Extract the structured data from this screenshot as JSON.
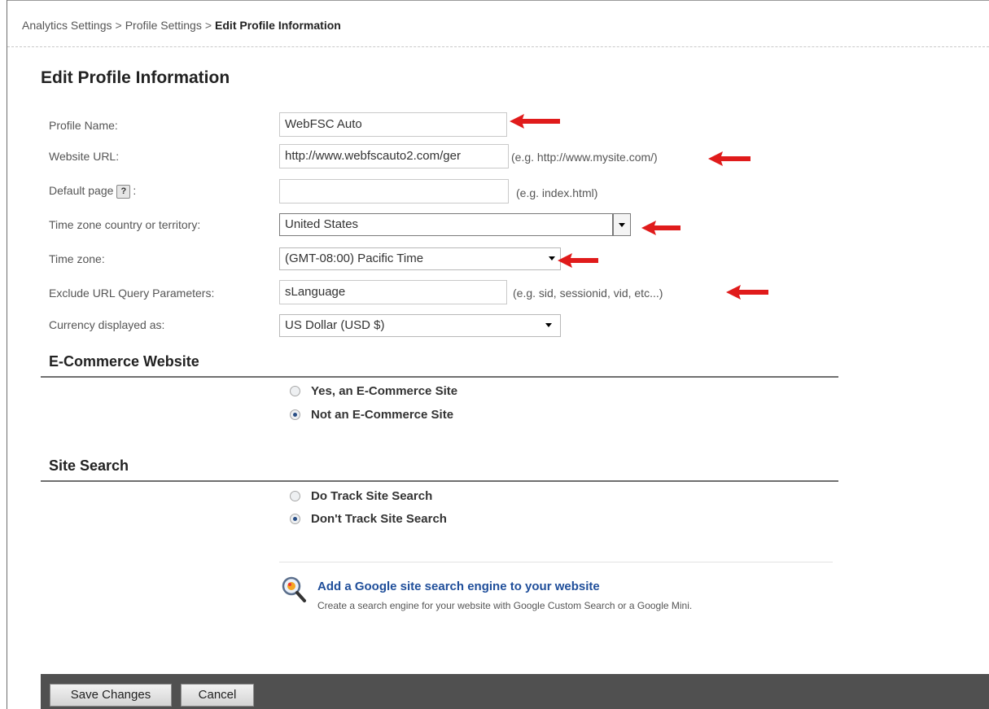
{
  "breadcrumb": {
    "items": [
      "Analytics Settings",
      "Profile Settings"
    ],
    "separator": ">",
    "current": "Edit Profile Information"
  },
  "page_title": "Edit Profile Information",
  "form": {
    "profile_name": {
      "label": "Profile Name:",
      "value": "WebFSC Auto"
    },
    "website_url": {
      "label": "Website URL:",
      "value": "http://www.webfscauto2.com/ger",
      "hint": "(e.g. http://www.mysite.com/)"
    },
    "default_page": {
      "label": "Default page",
      "label_suffix": ":",
      "help_glyph": "?",
      "value": "",
      "hint": "(e.g. index.html)"
    },
    "time_zone_country": {
      "label": "Time zone country or territory:",
      "value": "United States"
    },
    "time_zone": {
      "label": "Time zone:",
      "value": "(GMT-08:00) Pacific Time"
    },
    "exclude_params": {
      "label": "Exclude URL Query Parameters:",
      "value": "sLanguage",
      "hint": "(e.g. sid, sessionid, vid, etc...)"
    },
    "currency": {
      "label": "Currency displayed as:",
      "value": "US Dollar (USD $)"
    }
  },
  "ecommerce": {
    "title": "E-Commerce Website",
    "options": [
      {
        "label": "Yes, an E-Commerce Site",
        "selected": false
      },
      {
        "label": "Not an E-Commerce Site",
        "selected": true
      }
    ]
  },
  "site_search": {
    "title": "Site Search",
    "options": [
      {
        "label": "Do Track Site Search",
        "selected": false
      },
      {
        "label": "Don't Track Site Search",
        "selected": true
      }
    ]
  },
  "promo": {
    "icon": "magnifier-icon",
    "link": "Add a Google site search engine to your website",
    "description": "Create a search engine for your website with Google Custom Search or a Google Mini."
  },
  "footer": {
    "save_label": "Save Changes",
    "cancel_label": "Cancel"
  },
  "colors": {
    "annotation_arrow": "#e01b1b",
    "link": "#1f4e9a",
    "footer_bar": "#505050"
  }
}
